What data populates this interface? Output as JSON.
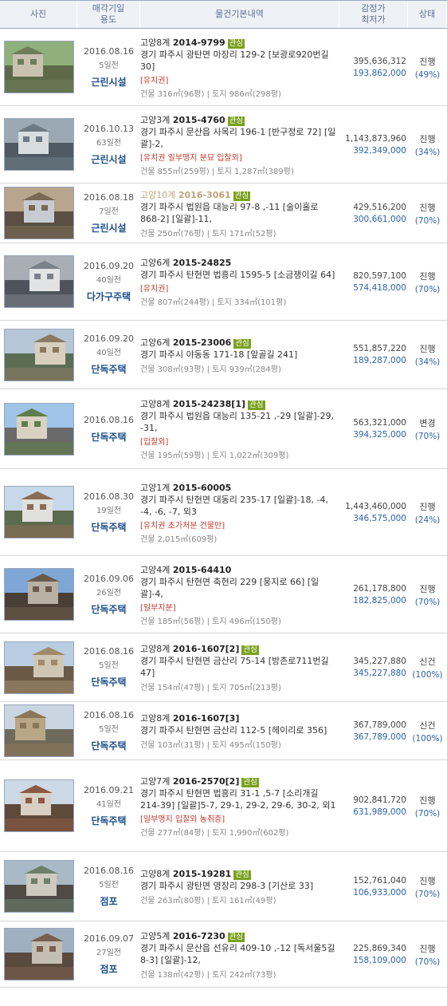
{
  "header": {
    "photo": "사진",
    "date_line1": "매각기일",
    "date_line2": "용도",
    "info": "물건기본내역",
    "price_line1": "감정가",
    "price_line2": "최저가",
    "status": "상태"
  },
  "rows": [
    {
      "date": "2016.08.16",
      "days": "5일전",
      "use": "근린시설",
      "court": "고양8계",
      "case": "2014-9799",
      "tag": "관심",
      "addr": "경기 파주시 광탄면 마장리 129-2 [보광로920번길 30]",
      "notes": "[유치권]",
      "area": "건물 316㎡(96평) | 토지 986㎡(298평)",
      "appraisal": "395,636,312",
      "minimum": "193,862,000",
      "status": "진행",
      "pct": "(49%)"
    },
    {
      "date": "2016.10.13",
      "days": "63일전",
      "use": "근린시설",
      "court": "고양3계",
      "case": "2015-4760",
      "tag": "관심",
      "addr": "경기 파주시 문산읍 사목리 196-1 [반구정로 72] [일괄]-2,",
      "notes": "[유치권  일부맹지 분묘  입찰외]",
      "area": "건물 855㎡(259평) | 토지 1,287㎡(389평)",
      "appraisal": "1,143,873,960",
      "minimum": "392,349,000",
      "status": "진행",
      "pct": "(34%)"
    },
    {
      "date": "2016.08.18",
      "days": "7일전",
      "use": "근린시설",
      "court": "고양10계",
      "case": "2016-3061",
      "tag": "관심",
      "addr": "경기 파주시 법원읍 대능리 97-8 ,-11 [술이홀로 868-2] [일괄]-11,",
      "notes": "",
      "area": "건물 250㎡(76평) | 토지 171㎡(52평)",
      "appraisal": "429,516,200",
      "minimum": "300,661,000",
      "status": "진행",
      "pct": "(70%)"
    },
    {
      "date": "2016.09.20",
      "days": "40일전",
      "use": "다가구주택",
      "court": "고양6계",
      "case": "2015-24825",
      "tag": "",
      "addr": "경기 파주시 탄현면 법흥리 1595-5 [소금쟁이길 64]",
      "notes": "[유치권]",
      "area": "건물 807㎡(244평) | 토지 334㎡(101평)",
      "appraisal": "820,597,100",
      "minimum": "574,418,000",
      "status": "진행",
      "pct": "(70%)"
    },
    {
      "date": "2016.09.20",
      "days": "40일전",
      "use": "단독주택",
      "court": "고양6계",
      "case": "2015-23006",
      "tag": "관심",
      "addr": "경기 파주시 야동동 171-18 [앞골길 241]",
      "notes": "",
      "area": "건물 308㎡(93평) | 토지 939㎡(284평)",
      "appraisal": "551,857,220",
      "minimum": "189,287,000",
      "status": "진행",
      "pct": "(34%)"
    },
    {
      "date": "2016.08.16",
      "days": "",
      "use": "단독주택",
      "court": "고양8계",
      "case": "2015-24238[1]",
      "tag": "관심",
      "addr": "경기 파주시 법원읍 대능리 135-21 ,-29 [일괄]-29, -31,",
      "notes": "[입찰외]",
      "area": "건물 195㎡(59평) | 토지 1,022㎡(309평)",
      "appraisal": "563,321,000",
      "minimum": "394,325,000",
      "status": "변경",
      "pct": "(70%)"
    },
    {
      "date": "2016.08.30",
      "days": "19일전",
      "use": "단독주택",
      "court": "고양1계",
      "case": "2015-60005",
      "tag": "",
      "addr": "경기 파주시 탄현면 대동리 235-17 [일괄]-18, -4, -4, -6, -7, 외3",
      "notes": "[유치권  초가처분  건물만]",
      "area": "건물 2,015㎡(609평)",
      "appraisal": "1,443,460,000",
      "minimum": "346,575,000",
      "status": "진행",
      "pct": "(24%)"
    },
    {
      "date": "2016.09.06",
      "days": "26일전",
      "use": "단독주택",
      "court": "고양4계",
      "case": "2015-64410",
      "tag": "",
      "addr": "경기 파주시 탄현면 축현리 229 [웅지로 66] [일괄]-4,",
      "notes": "[일부지분]",
      "area": "건물 185㎡(56평) | 토지 496㎡(150평)",
      "appraisal": "261,178,800",
      "minimum": "182,825,000",
      "status": "진행",
      "pct": "(70%)"
    },
    {
      "date": "2016.08.16",
      "days": "5일전",
      "use": "단독주택",
      "court": "고양8계",
      "case": "2016-1607[2]",
      "tag": "관심",
      "addr": "경기 파주시 탄현면 금산리 75-14 [방촌로711번길 47]",
      "notes": "",
      "area": "건물 154㎡(47평) | 토지 705㎡(213평)",
      "appraisal": "345,227,880",
      "minimum": "345,227,880",
      "status": "신건",
      "pct": "(100%)"
    },
    {
      "date": "2016.08.16",
      "days": "5일전",
      "use": "단독주택",
      "court": "고양8계",
      "case": "2016-1607[3]",
      "tag": "",
      "addr": "경기 파주시 탄현면 금산리 112-5 [헤이리로 356]",
      "notes": "",
      "area": "건물 103㎡(31평) | 토지 495㎡(150평)",
      "appraisal": "367,789,000",
      "minimum": "367,789,000",
      "status": "신건",
      "pct": "(100%)"
    },
    {
      "date": "2016.09.21",
      "days": "41일전",
      "use": "단독주택",
      "court": "고양7계",
      "case": "2016-2570[2]",
      "tag": "관심",
      "addr": "경기 파주시 탄현면 법흥리 31-1 ,5-7 [소리개길 214-39] [일괄]5-7, 29-1, 29-2, 29-6, 30-2, 외1",
      "notes": "[일부맹지 입찰외  농취증]",
      "area": "건물 277㎡(84평) | 토지 1,990㎡(602평)",
      "appraisal": "902,841,720",
      "minimum": "631,989,000",
      "status": "진행",
      "pct": "(70%)"
    },
    {
      "date": "2016.08.16",
      "days": "5일전",
      "use": "점포",
      "court": "고양8계",
      "case": "2015-19281",
      "tag": "관심",
      "addr": "경기 파주시 광탄면 영장리 298-3 [기산로 33]",
      "notes": "",
      "area": "건물 263㎡(80평) | 토지 161㎡(49평)",
      "appraisal": "152,761,040",
      "minimum": "106,933,000",
      "status": "진행",
      "pct": "(70%)"
    },
    {
      "date": "2016.09.07",
      "days": "27일전",
      "use": "점포",
      "court": "고양5계",
      "case": "2016-7230",
      "tag": "관심",
      "addr": "경기 파주시 문산읍 선유리 409-10 ,-12 [독서울5길 8-3] [일괄]-12,",
      "notes": "",
      "area": "건물 138㎡(42평) | 토지 242㎡(73평)",
      "appraisal": "225,869,340",
      "minimum": "158,109,000",
      "status": "진행",
      "pct": "(70%)"
    }
  ]
}
